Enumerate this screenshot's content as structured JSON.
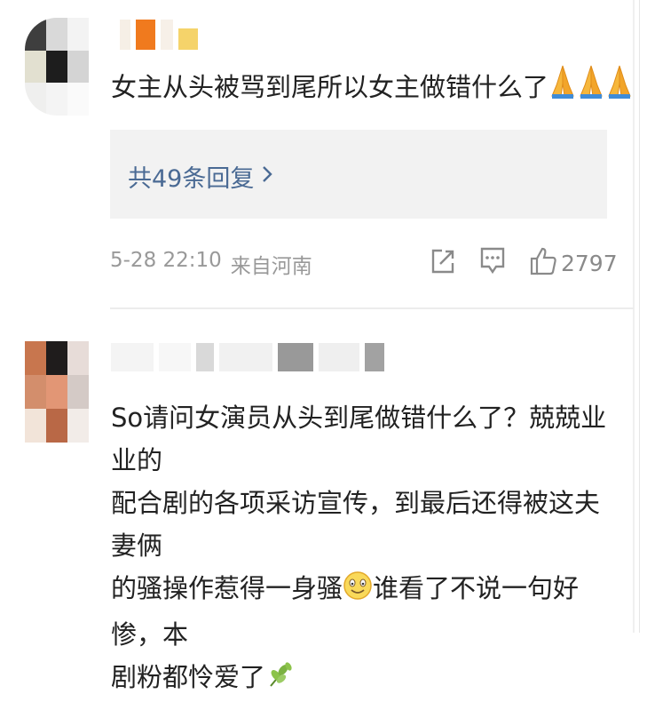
{
  "comments": [
    {
      "text_main": "女主从头被骂到尾所以女主做错什么了",
      "emoji_icons": [
        "folded-hands-icon",
        "folded-hands-icon",
        "folded-hands-icon"
      ],
      "reply_label": "共49条回复",
      "timestamp": "5-28 22:10",
      "location": "来自河南",
      "like_count": "2797"
    },
    {
      "line1": "So请问女演员从头到尾做错什么了？兢兢业业的",
      "line2": "配合剧的各项采访宣传，到最后还得被这夫妻俩",
      "line3_a": "的骚操作惹得一身骚",
      "line3_b": "谁看了不说一句好惨，本",
      "line4": "剧粉都怜爱了",
      "emoji_icons": [
        "smile-face-icon",
        "leaf-icon"
      ]
    }
  ],
  "colors": {
    "text": "#222222",
    "link": "#4a6a94",
    "meta": "#999999",
    "reply_bg": "#f2f2f2"
  }
}
